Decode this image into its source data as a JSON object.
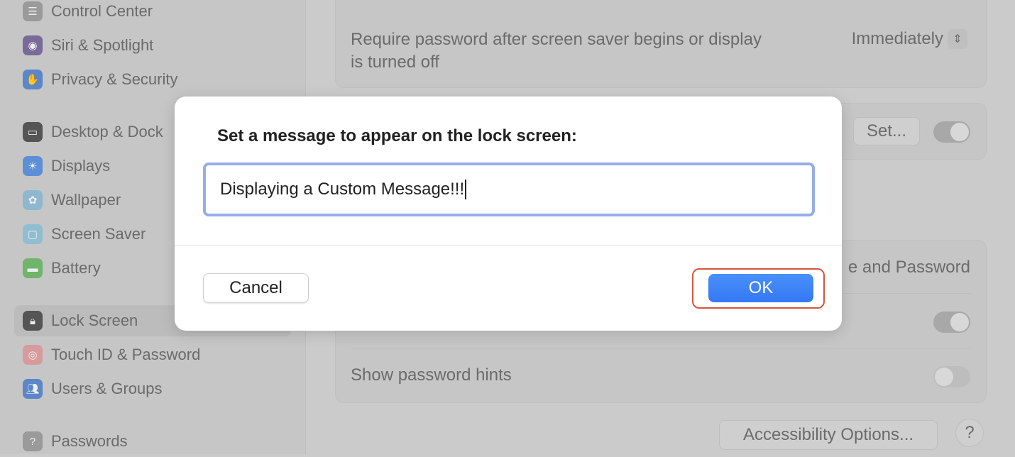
{
  "sidebar": {
    "items": [
      {
        "label": "Control Center",
        "icon": "control-center-icon",
        "color": "#9a9a9a"
      },
      {
        "label": "Siri & Spotlight",
        "icon": "siri-icon",
        "color": "#7a6a9a"
      },
      {
        "label": "Privacy & Security",
        "icon": "hand-icon",
        "color": "#5b86c9"
      },
      {
        "label": "Desktop & Dock",
        "icon": "dock-icon",
        "color": "#555555"
      },
      {
        "label": "Displays",
        "icon": "sun-icon",
        "color": "#5b8fd6"
      },
      {
        "label": "Wallpaper",
        "icon": "flower-icon",
        "color": "#8fb7cf"
      },
      {
        "label": "Screen Saver",
        "icon": "screen-saver-icon",
        "color": "#8fbdd2"
      },
      {
        "label": "Battery",
        "icon": "battery-icon",
        "color": "#6fb56a"
      },
      {
        "label": "Lock Screen",
        "icon": "lock-icon",
        "color": "#555555",
        "selected": true
      },
      {
        "label": "Touch ID & Password",
        "icon": "fingerprint-icon",
        "color": "#d89b9b"
      },
      {
        "label": "Users & Groups",
        "icon": "users-icon",
        "color": "#5b86c9"
      },
      {
        "label": "Passwords",
        "icon": "key-icon",
        "color": "#9a9a9a"
      }
    ]
  },
  "main": {
    "require_password_label": "Require password after screen saver begins or display is turned off",
    "require_password_value": "Immediately",
    "set_button": "Set...",
    "message_toggle_on": true,
    "login_section_partial": "e and Password",
    "row_toggle_on": true,
    "show_hints_label": "Show password hints",
    "show_hints_on": false,
    "accessibility_button": "Accessibility Options...",
    "help_button": "?"
  },
  "dialog": {
    "title": "Set a message to appear on the lock screen:",
    "input_value": "Displaying a Custom Message!!!",
    "cancel_label": "Cancel",
    "ok_label": "OK",
    "accent": "#3478f6",
    "highlight_color": "#d0583a"
  }
}
